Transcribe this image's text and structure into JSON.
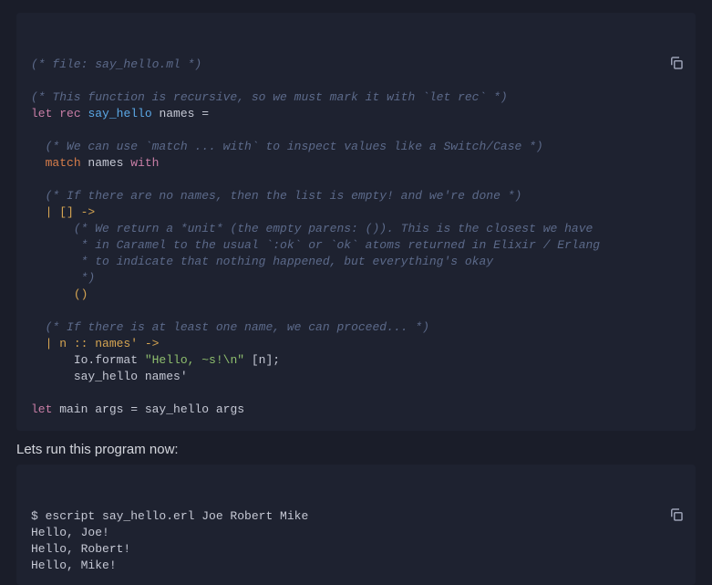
{
  "code": {
    "c1": "(* file: say_hello.ml *)",
    "c2": "(* This function is recursive, so we must mark it with `let rec` *)",
    "let1_let": "let",
    "let1_rec": "rec",
    "let1_name": "say_hello",
    "let1_rest": " names =",
    "c3": "(* We can use `match ... with` to inspect values like a Switch/Case *)",
    "match_kw": "match",
    "match_var": " names ",
    "with_kw": "with",
    "c4": "(* If there are no names, then the list is empty! and we're done *)",
    "arm1_pat": "| [] ->",
    "c5a": "(* We return a *unit* (the empty parens: ()). This is the closest we have",
    "c5b": " * in Caramel to the usual `:ok` or `ok` atoms returned in Elixir / Erlang",
    "c5c": " * to indicate that nothing happened, but everything's okay",
    "c5d": " *)",
    "unit": "()",
    "c6": "(* If there is at least one name, we can proceed... *)",
    "arm2_pat": "| n :: names' ->",
    "call_mod": "Io.format ",
    "call_str": "\"Hello, ~s!\\n\"",
    "call_args": " [n];",
    "rec_call": "say_hello names'",
    "let2_let": "let",
    "let2_rest": " main args = say_hello args"
  },
  "prose": {
    "run_text": "Lets run this program now:"
  },
  "shell": {
    "cmd": "$ escript say_hello.erl Joe Robert Mike",
    "out1": "Hello, Joe!",
    "out2": "Hello, Robert!",
    "out3": "Hello, Mike!"
  }
}
